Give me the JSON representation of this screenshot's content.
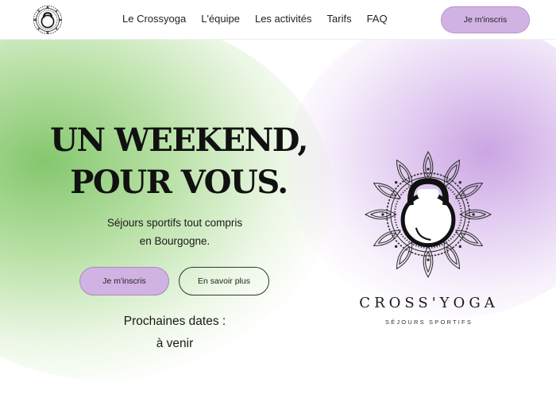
{
  "header": {
    "logo_icon": "mandala-kettlebell-logo-icon",
    "nav": [
      {
        "label": "Le Crossyoga"
      },
      {
        "label": "L'équipe"
      },
      {
        "label": "Les activités"
      },
      {
        "label": "Tarifs"
      },
      {
        "label": "FAQ"
      }
    ],
    "signup_label": "Je m'inscris"
  },
  "hero": {
    "title_line1": "UN WEEKEND,",
    "title_line2": "POUR VOUS.",
    "subtitle_line1": "Séjours sportifs tout compris",
    "subtitle_line2": "en Bourgogne.",
    "signup_label": "Je m'inscris",
    "learn_more_label": "En savoir plus",
    "dates_title": "Prochaines dates :",
    "dates_value": "à venir"
  },
  "brand": {
    "logo_icon": "mandala-kettlebell-logo-icon",
    "name": "CROSS'YOGA",
    "tagline": "SÉJOURS SPORTIFS"
  },
  "colors": {
    "accent_purple": "#d1b3e3",
    "bg_green": "#7ec466",
    "bg_purple": "#c8a0e1",
    "text": "#1a1a1a"
  }
}
